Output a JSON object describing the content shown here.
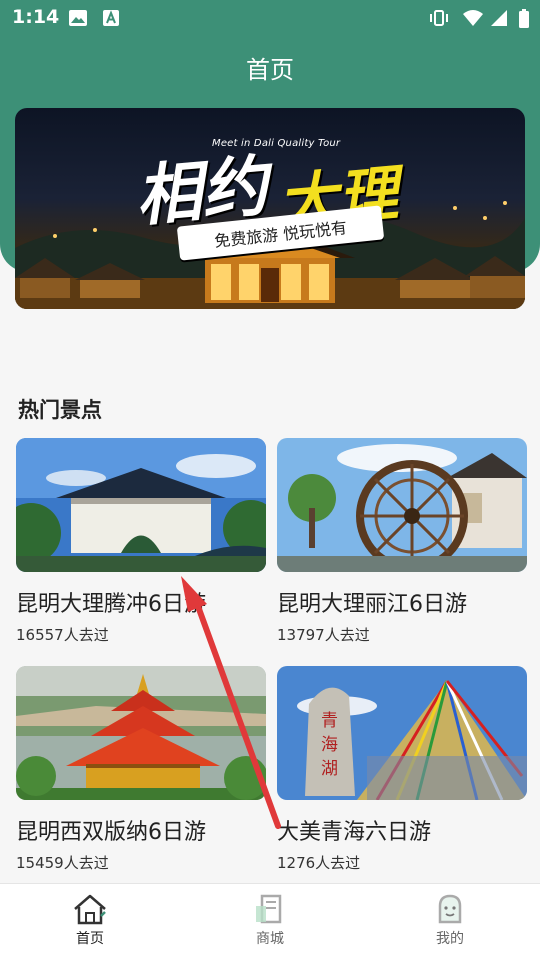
{
  "status_bar": {
    "time": "1:14"
  },
  "header": {
    "title": "首页"
  },
  "banner": {
    "subtitle": "Meet in Dali Quality Tour",
    "title_part1": "相约",
    "title_part2": "大理",
    "ribbon": "免费旅游  悦玩悦有"
  },
  "section": {
    "title": "热门景点"
  },
  "tours": [
    {
      "title": "昆明大理腾冲6日游",
      "count": "16557人去过"
    },
    {
      "title": "昆明大理丽江6日游",
      "count": "13797人去过"
    },
    {
      "title": "昆明西双版纳6日游",
      "count": "15459人去过"
    },
    {
      "title": "大美青海六日游",
      "count": "1276人去过"
    }
  ],
  "bottom_nav": [
    {
      "label": "首页",
      "icon": "home-icon",
      "active": true
    },
    {
      "label": "商城",
      "icon": "mall-icon",
      "active": false
    },
    {
      "label": "我的",
      "icon": "profile-icon",
      "active": false
    }
  ],
  "colors": {
    "theme": "#3d9077",
    "accent": "#f3df1f",
    "arrow": "#e0393a"
  }
}
